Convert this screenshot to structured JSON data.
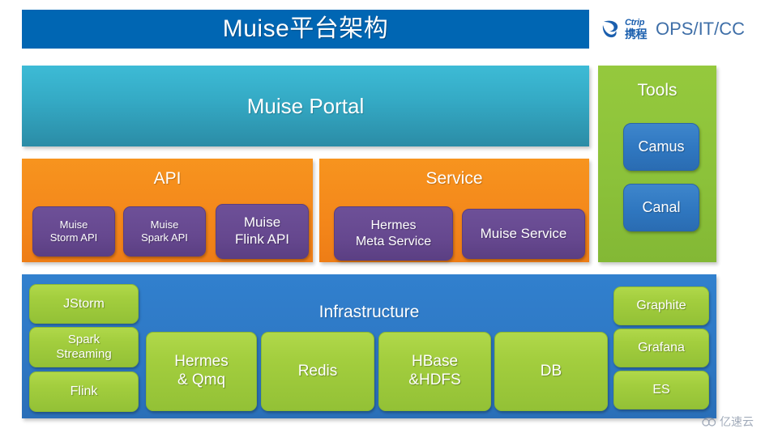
{
  "slide": {
    "title": "Muise平台架构",
    "background_color": "#ffffff"
  },
  "brand": {
    "logo_cn_top": "Ctrip",
    "logo_cn_bottom": "携程",
    "department": "OPS/IT/CC",
    "logo_color": "#1B5FAE",
    "text_color": "#3F6FA8"
  },
  "colors": {
    "title_bar": "#0066B3",
    "portal": "#34A9C4",
    "api_service": "#F4881B",
    "purple_chip": "#66488F",
    "tools_panel": "#8CC23A",
    "blue_chip": "#2F77C0",
    "infrastructure": "#2E78C4",
    "green_chip": "#A3CE3E"
  },
  "portal": {
    "label": "Muise Portal"
  },
  "api": {
    "label": "API",
    "items": [
      {
        "lines": [
          "Muise",
          "Storm  API"
        ]
      },
      {
        "lines": [
          "Muise",
          "Spark API"
        ]
      },
      {
        "lines": [
          "Muise",
          "Flink API"
        ]
      }
    ]
  },
  "service": {
    "label": "Service",
    "items": [
      {
        "lines": [
          "Hermes",
          "Meta Service"
        ]
      },
      {
        "lines": [
          "Muise Service"
        ]
      }
    ]
  },
  "tools": {
    "label": "Tools",
    "items": [
      {
        "label": "Camus"
      },
      {
        "label": "Canal"
      }
    ]
  },
  "infrastructure": {
    "label": "Infrastructure",
    "left_stack": [
      {
        "lines": [
          "JStorm"
        ]
      },
      {
        "lines": [
          "Spark",
          "Streaming"
        ]
      },
      {
        "lines": [
          "Flink"
        ]
      }
    ],
    "center_row": [
      {
        "lines": [
          "Hermes",
          "& Qmq"
        ]
      },
      {
        "lines": [
          "Redis"
        ]
      },
      {
        "lines": [
          "HBase",
          "&HDFS"
        ]
      },
      {
        "lines": [
          "DB"
        ]
      }
    ],
    "right_stack": [
      {
        "lines": [
          "Graphite"
        ]
      },
      {
        "lines": [
          "Grafana"
        ]
      },
      {
        "lines": [
          "ES"
        ]
      }
    ]
  },
  "watermark": {
    "text": "亿速云",
    "icon": "cloud-icon"
  }
}
